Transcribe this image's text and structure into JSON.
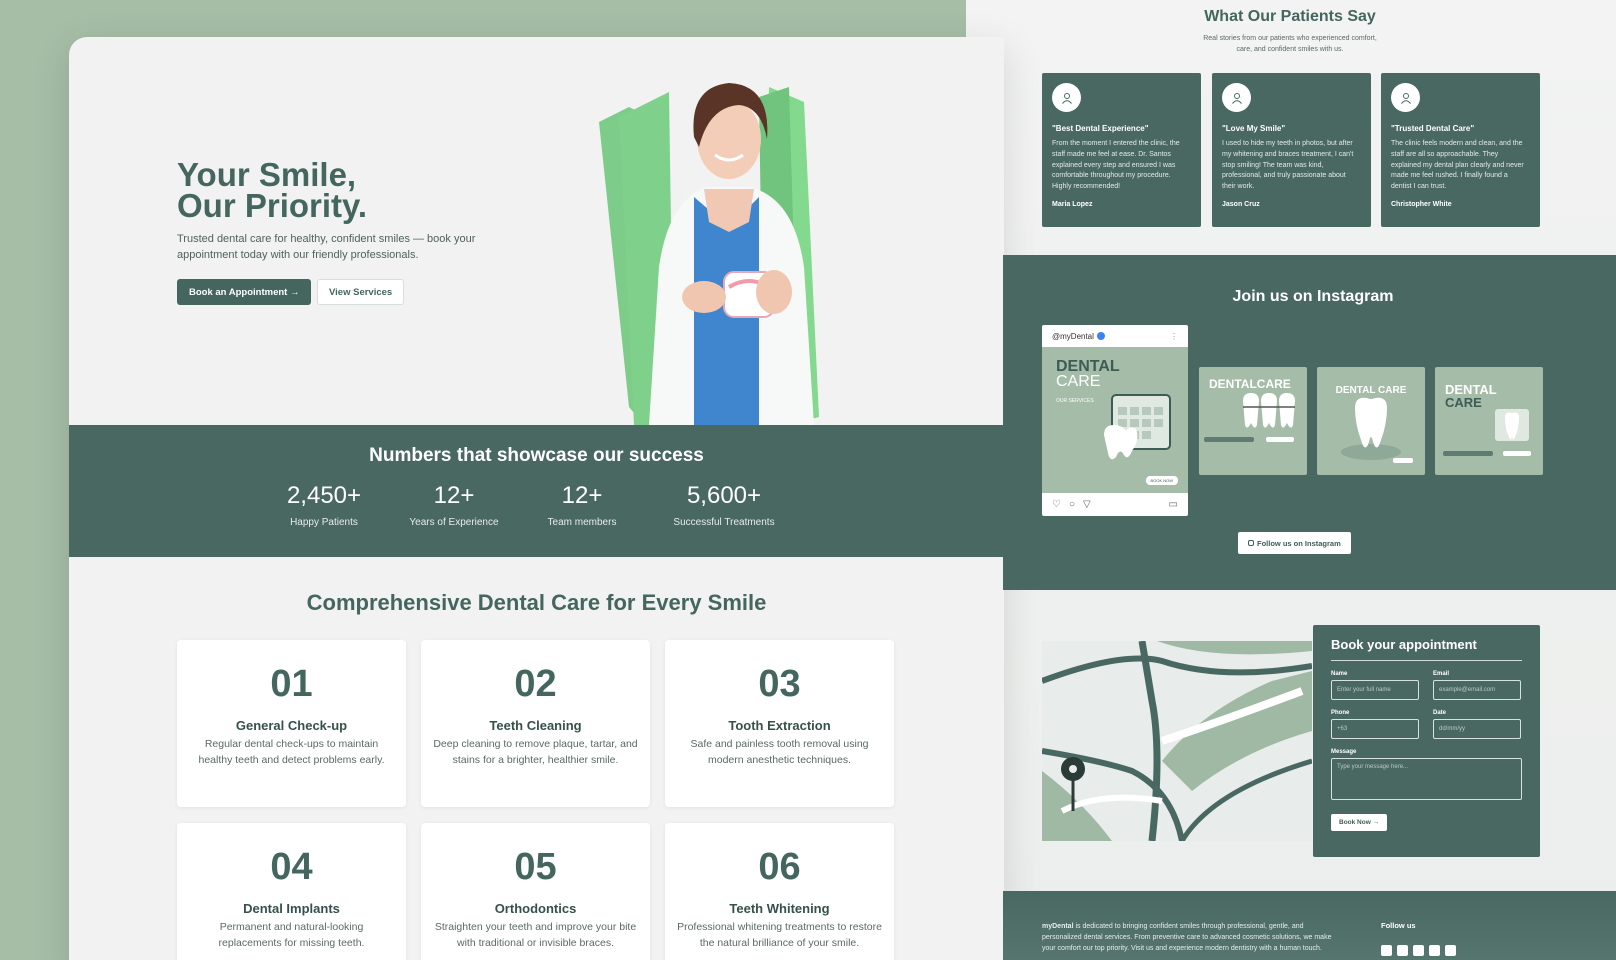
{
  "hero": {
    "title_line1": "Your Smile,",
    "title_line2": "Our Priority.",
    "subtitle": "Trusted dental care for healthy, confident smiles — book your appointment today with our friendly professionals.",
    "primary_button": "Book an Appointment →",
    "secondary_button": "View Services"
  },
  "stats": {
    "title": "Numbers that showcase our success",
    "items": [
      {
        "value": "2,450+",
        "label": "Happy Patients"
      },
      {
        "value": "12+",
        "label": "Years of Experience"
      },
      {
        "value": "12+",
        "label": "Team members"
      },
      {
        "value": "5,600+",
        "label": "Successful Treatments"
      }
    ]
  },
  "services": {
    "title": "Comprehensive Dental Care for Every Smile",
    "items": [
      {
        "num": "01",
        "title": "General Check-up",
        "desc": "Regular dental check-ups to maintain healthy teeth and detect problems early."
      },
      {
        "num": "02",
        "title": "Teeth Cleaning",
        "desc": "Deep cleaning to remove plaque, tartar, and stains for a brighter, healthier smile."
      },
      {
        "num": "03",
        "title": "Tooth Extraction",
        "desc": "Safe and painless tooth removal using modern anesthetic techniques."
      },
      {
        "num": "04",
        "title": "Dental Implants",
        "desc": "Permanent and natural-looking replacements for missing teeth."
      },
      {
        "num": "05",
        "title": "Orthodontics",
        "desc": "Straighten your teeth and improve your bite with traditional or invisible braces."
      },
      {
        "num": "06",
        "title": "Teeth Whitening",
        "desc": "Professional whitening treatments to restore the natural brilliance of your smile."
      }
    ]
  },
  "testimonials": {
    "title": "What Our Patients Say",
    "subtitle": "Real stories from our patients who experienced comfort, care, and confident smiles with us.",
    "items": [
      {
        "title": "\"Best Dental Experience\"",
        "text": "From the moment I entered the clinic, the staff made me feel at ease. Dr. Santos explained every step and ensured I was comfortable throughout my procedure. Highly recommended!",
        "name": "Maria Lopez"
      },
      {
        "title": "\"Love My Smile\"",
        "text": "I used to hide my teeth in photos, but after my whitening and braces treatment, I can't stop smiling! The team was kind, professional, and truly passionate about their work.",
        "name": "Jason Cruz"
      },
      {
        "title": "\"Trusted Dental Care\"",
        "text": "The clinic feels modern and clean, and the staff are all so approachable. They explained my dental plan clearly and never made me feel rushed. I finally found a dentist I can trust.",
        "name": "Christopher White"
      }
    ]
  },
  "instagram": {
    "title": "Join us on Instagram",
    "handle": "@myDental",
    "main_post_line1": "DENTAL",
    "main_post_line2": "CARE",
    "main_post_services": "OUR SERVICES",
    "post2_title": "DENTALCARE",
    "post3_title": "DENTAL CARE",
    "post4_line1": "DENTAL",
    "post4_line2": "CARE",
    "book_now": "BOOK NOW",
    "follow_button": "Follow us on Instagram"
  },
  "booking": {
    "title": "Book your appointment",
    "name_label": "Name",
    "name_placeholder": "Enter your full name",
    "email_label": "Email",
    "email_placeholder": "example@email.com",
    "phone_label": "Phone",
    "phone_placeholder": "+63",
    "date_label": "Date",
    "date_placeholder": "dd/mm/yy",
    "message_label": "Message",
    "message_placeholder": "Type your message here...",
    "submit": "Book Now →"
  },
  "footer": {
    "brand": "myDental",
    "text": " is dedicated to bringing confident smiles through professional, gentle, and personalized dental services. From preventive care to advanced cosmetic solutions, we make your comfort our top priority. Visit us and experience modern dentistry with a human touch.",
    "follow_label": "Follow us",
    "social": [
      "facebook-icon",
      "twitter-icon",
      "instagram-icon",
      "linkedin-icon",
      "youtube-icon"
    ]
  },
  "colors": {
    "primary": "#4a6862",
    "accent_green": "#7fd08a",
    "background": "#a6bda6"
  }
}
